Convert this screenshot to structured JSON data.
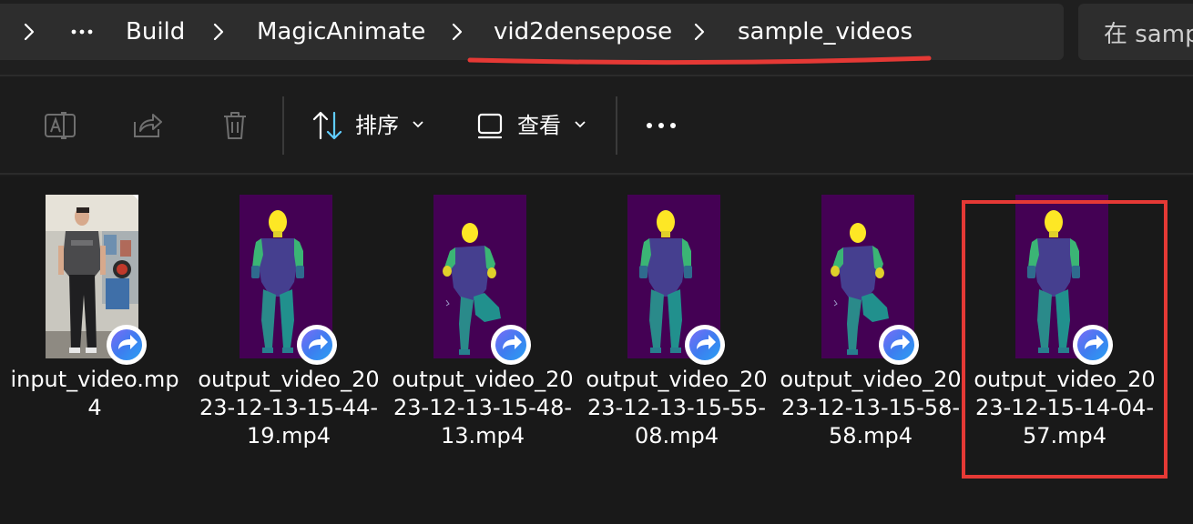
{
  "breadcrumb": {
    "items": [
      "Build",
      "MagicAnimate",
      "vid2densepose",
      "sample_videos"
    ],
    "overflow_icon": "ellipsis-icon",
    "separator_icon": "chevron-right-icon",
    "annotation_color": "#e53935"
  },
  "search": {
    "text": "在 samp"
  },
  "toolbar": {
    "rename_icon": "rename-icon",
    "share_icon": "share-icon",
    "delete_icon": "trash-icon",
    "sort_label": "排序",
    "view_label": "查看",
    "more_icon": "more-icon"
  },
  "files": [
    {
      "name": "input_video.mp4",
      "thumbnail": "photo",
      "badge_icon": "media-player-icon"
    },
    {
      "name": "output_video_2023-12-13-15-44-19.mp4",
      "thumbnail": "densepose-standing",
      "badge_icon": "media-player-icon"
    },
    {
      "name": "output_video_2023-12-13-15-48-13.mp4",
      "thumbnail": "densepose-one-leg",
      "badge_icon": "media-player-icon"
    },
    {
      "name": "output_video_2023-12-13-15-55-08.mp4",
      "thumbnail": "densepose-standing",
      "badge_icon": "media-player-icon"
    },
    {
      "name": "output_video_2023-12-13-15-58-58.mp4",
      "thumbnail": "densepose-one-leg",
      "badge_icon": "media-player-icon"
    },
    {
      "name": "output_video_2023-12-15-14-04-57.mp4",
      "thumbnail": "densepose-standing",
      "badge_icon": "media-player-icon",
      "highlighted": true
    }
  ],
  "colors": {
    "densepose_bg": "#440154",
    "densepose_head": "#fde725",
    "densepose_torso": "#453f8f",
    "highlight_box": "#e53935"
  }
}
